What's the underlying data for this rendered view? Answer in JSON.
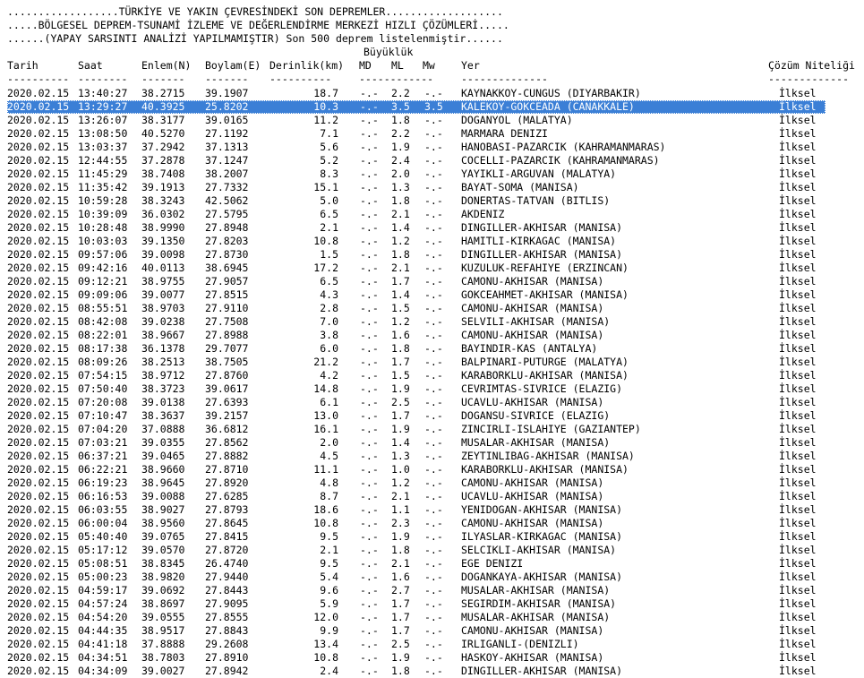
{
  "header": {
    "line1": "..................TÜRKİYE VE YAKIN ÇEVRESİNDEKİ SON DEPREMLER...................",
    "line2": ".....BÖLGESEL DEPREM-TSUNAMİ İZLEME VE DEĞERLENDİRME MERKEZİ HIZLI ÇÖZÜMLERİ.....",
    "line3": "......(YAPAY SARSINTI ANALİZİ YAPILMAMIŞTIR) Son 500 deprem listelenmiştir......",
    "magnitude_group": "Büyüklük"
  },
  "columns": {
    "date": "Tarih",
    "time": "Saat",
    "lat": "Enlem(N)",
    "lon": "Boylam(E)",
    "depth": "Derinlik(km)",
    "md": "MD",
    "ml": "ML",
    "mw": "Mw",
    "place": "Yer",
    "quality": "Çözüm Niteliği"
  },
  "separators": {
    "date": "----------",
    "time": "--------",
    "lat": "-------",
    "lon": "-------",
    "depth": "----------",
    "mag": "------------",
    "place": "--------------",
    "quality": "-------------"
  },
  "selected_index": 1,
  "rows": [
    {
      "date": "2020.02.15",
      "time": "13:40:27",
      "lat": "38.2715",
      "lon": "39.1907",
      "depth": "18.7",
      "md": "-.-",
      "ml": "2.2",
      "mw": "-.-",
      "place": "KAYNAKKOY-CUNGUS (DIYARBAKIR)",
      "quality": "İlksel"
    },
    {
      "date": "2020.02.15",
      "time": "13:29:27",
      "lat": "40.3925",
      "lon": "25.8202",
      "depth": "10.3",
      "md": "-.-",
      "ml": "3.5",
      "mw": "3.5",
      "place": "KALEKOY-GOKCEADA (CANAKKALE)",
      "quality": "İlksel"
    },
    {
      "date": "2020.02.15",
      "time": "13:26:07",
      "lat": "38.3177",
      "lon": "39.0165",
      "depth": "11.2",
      "md": "-.-",
      "ml": "1.8",
      "mw": "-.-",
      "place": "DOGANYOL (MALATYA)",
      "quality": "İlksel"
    },
    {
      "date": "2020.02.15",
      "time": "13:08:50",
      "lat": "40.5270",
      "lon": "27.1192",
      "depth": "7.1",
      "md": "-.-",
      "ml": "2.2",
      "mw": "-.-",
      "place": "MARMARA DENIZI",
      "quality": "İlksel"
    },
    {
      "date": "2020.02.15",
      "time": "13:03:37",
      "lat": "37.2942",
      "lon": "37.1313",
      "depth": "5.6",
      "md": "-.-",
      "ml": "1.9",
      "mw": "-.-",
      "place": "HANOBASI-PAZARCIK (KAHRAMANMARAS)",
      "quality": "İlksel"
    },
    {
      "date": "2020.02.15",
      "time": "12:44:55",
      "lat": "37.2878",
      "lon": "37.1247",
      "depth": "5.2",
      "md": "-.-",
      "ml": "2.4",
      "mw": "-.-",
      "place": "COCELLI-PAZARCIK (KAHRAMANMARAS)",
      "quality": "İlksel"
    },
    {
      "date": "2020.02.15",
      "time": "11:45:29",
      "lat": "38.7408",
      "lon": "38.2007",
      "depth": "8.3",
      "md": "-.-",
      "ml": "2.0",
      "mw": "-.-",
      "place": "YAYIKLI-ARGUVAN (MALATYA)",
      "quality": "İlksel"
    },
    {
      "date": "2020.02.15",
      "time": "11:35:42",
      "lat": "39.1913",
      "lon": "27.7332",
      "depth": "15.1",
      "md": "-.-",
      "ml": "1.3",
      "mw": "-.-",
      "place": "BAYAT-SOMA (MANISA)",
      "quality": "İlksel"
    },
    {
      "date": "2020.02.15",
      "time": "10:59:28",
      "lat": "38.3243",
      "lon": "42.5062",
      "depth": "5.0",
      "md": "-.-",
      "ml": "1.8",
      "mw": "-.-",
      "place": "DONERTAS-TATVAN (BITLIS)",
      "quality": "İlksel"
    },
    {
      "date": "2020.02.15",
      "time": "10:39:09",
      "lat": "36.0302",
      "lon": "27.5795",
      "depth": "6.5",
      "md": "-.-",
      "ml": "2.1",
      "mw": "-.-",
      "place": "AKDENIZ",
      "quality": "İlksel"
    },
    {
      "date": "2020.02.15",
      "time": "10:28:48",
      "lat": "38.9990",
      "lon": "27.8948",
      "depth": "2.1",
      "md": "-.-",
      "ml": "1.4",
      "mw": "-.-",
      "place": "DINGILLER-AKHISAR (MANISA)",
      "quality": "İlksel"
    },
    {
      "date": "2020.02.15",
      "time": "10:03:03",
      "lat": "39.1350",
      "lon": "27.8203",
      "depth": "10.8",
      "md": "-.-",
      "ml": "1.2",
      "mw": "-.-",
      "place": "HAMITLI-KIRKAGAC (MANISA)",
      "quality": "İlksel"
    },
    {
      "date": "2020.02.15",
      "time": "09:57:06",
      "lat": "39.0098",
      "lon": "27.8730",
      "depth": "1.5",
      "md": "-.-",
      "ml": "1.8",
      "mw": "-.-",
      "place": "DINGILLER-AKHISAR (MANISA)",
      "quality": "İlksel"
    },
    {
      "date": "2020.02.15",
      "time": "09:42:16",
      "lat": "40.0113",
      "lon": "38.6945",
      "depth": "17.2",
      "md": "-.-",
      "ml": "2.1",
      "mw": "-.-",
      "place": "KUZULUK-REFAHIYE (ERZINCAN)",
      "quality": "İlksel"
    },
    {
      "date": "2020.02.15",
      "time": "09:12:21",
      "lat": "38.9755",
      "lon": "27.9057",
      "depth": "6.5",
      "md": "-.-",
      "ml": "1.7",
      "mw": "-.-",
      "place": "CAMONU-AKHISAR (MANISA)",
      "quality": "İlksel"
    },
    {
      "date": "2020.02.15",
      "time": "09:09:06",
      "lat": "39.0077",
      "lon": "27.8515",
      "depth": "4.3",
      "md": "-.-",
      "ml": "1.4",
      "mw": "-.-",
      "place": "GOKCEAHMET-AKHISAR (MANISA)",
      "quality": "İlksel"
    },
    {
      "date": "2020.02.15",
      "time": "08:55:51",
      "lat": "38.9703",
      "lon": "27.9110",
      "depth": "2.8",
      "md": "-.-",
      "ml": "1.5",
      "mw": "-.-",
      "place": "CAMONU-AKHISAR (MANISA)",
      "quality": "İlksel"
    },
    {
      "date": "2020.02.15",
      "time": "08:42:08",
      "lat": "39.0238",
      "lon": "27.7508",
      "depth": "7.0",
      "md": "-.-",
      "ml": "1.2",
      "mw": "-.-",
      "place": "SELVILI-AKHISAR (MANISA)",
      "quality": "İlksel"
    },
    {
      "date": "2020.02.15",
      "time": "08:22:01",
      "lat": "38.9667",
      "lon": "27.8988",
      "depth": "3.8",
      "md": "-.-",
      "ml": "1.6",
      "mw": "-.-",
      "place": "CAMONU-AKHISAR (MANISA)",
      "quality": "İlksel"
    },
    {
      "date": "2020.02.15",
      "time": "08:17:38",
      "lat": "36.1378",
      "lon": "29.7077",
      "depth": "6.0",
      "md": "-.-",
      "ml": "1.8",
      "mw": "-.-",
      "place": "BAYINDIR-KAS (ANTALYA)",
      "quality": "İlksel"
    },
    {
      "date": "2020.02.15",
      "time": "08:09:26",
      "lat": "38.2513",
      "lon": "38.7505",
      "depth": "21.2",
      "md": "-.-",
      "ml": "1.7",
      "mw": "-.-",
      "place": "BALPINARI-PUTURGE (MALATYA)",
      "quality": "İlksel"
    },
    {
      "date": "2020.02.15",
      "time": "07:54:15",
      "lat": "38.9712",
      "lon": "27.8760",
      "depth": "4.2",
      "md": "-.-",
      "ml": "1.5",
      "mw": "-.-",
      "place": "KARABORKLU-AKHISAR (MANISA)",
      "quality": "İlksel"
    },
    {
      "date": "2020.02.15",
      "time": "07:50:40",
      "lat": "38.3723",
      "lon": "39.0617",
      "depth": "14.8",
      "md": "-.-",
      "ml": "1.9",
      "mw": "-.-",
      "place": "CEVRIMTAS-SIVRICE (ELAZIG)",
      "quality": "İlksel"
    },
    {
      "date": "2020.02.15",
      "time": "07:20:08",
      "lat": "39.0138",
      "lon": "27.6393",
      "depth": "6.1",
      "md": "-.-",
      "ml": "2.5",
      "mw": "-.-",
      "place": "UCAVLU-AKHISAR (MANISA)",
      "quality": "İlksel"
    },
    {
      "date": "2020.02.15",
      "time": "07:10:47",
      "lat": "38.3637",
      "lon": "39.2157",
      "depth": "13.0",
      "md": "-.-",
      "ml": "1.7",
      "mw": "-.-",
      "place": "DOGANSU-SIVRICE (ELAZIG)",
      "quality": "İlksel"
    },
    {
      "date": "2020.02.15",
      "time": "07:04:20",
      "lat": "37.0888",
      "lon": "36.6812",
      "depth": "16.1",
      "md": "-.-",
      "ml": "1.9",
      "mw": "-.-",
      "place": "ZINCIRLI-ISLAHIYE (GAZIANTEP)",
      "quality": "İlksel"
    },
    {
      "date": "2020.02.15",
      "time": "07:03:21",
      "lat": "39.0355",
      "lon": "27.8562",
      "depth": "2.0",
      "md": "-.-",
      "ml": "1.4",
      "mw": "-.-",
      "place": "MUSALAR-AKHISAR (MANISA)",
      "quality": "İlksel"
    },
    {
      "date": "2020.02.15",
      "time": "06:37:21",
      "lat": "39.0465",
      "lon": "27.8882",
      "depth": "4.5",
      "md": "-.-",
      "ml": "1.3",
      "mw": "-.-",
      "place": "ZEYTINLIBAG-AKHISAR (MANISA)",
      "quality": "İlksel"
    },
    {
      "date": "2020.02.15",
      "time": "06:22:21",
      "lat": "38.9660",
      "lon": "27.8710",
      "depth": "11.1",
      "md": "-.-",
      "ml": "1.0",
      "mw": "-.-",
      "place": "KARABORKLU-AKHISAR (MANISA)",
      "quality": "İlksel"
    },
    {
      "date": "2020.02.15",
      "time": "06:19:23",
      "lat": "38.9645",
      "lon": "27.8920",
      "depth": "4.8",
      "md": "-.-",
      "ml": "1.2",
      "mw": "-.-",
      "place": "CAMONU-AKHISAR (MANISA)",
      "quality": "İlksel"
    },
    {
      "date": "2020.02.15",
      "time": "06:16:53",
      "lat": "39.0088",
      "lon": "27.6285",
      "depth": "8.7",
      "md": "-.-",
      "ml": "2.1",
      "mw": "-.-",
      "place": "UCAVLU-AKHISAR (MANISA)",
      "quality": "İlksel"
    },
    {
      "date": "2020.02.15",
      "time": "06:03:55",
      "lat": "38.9027",
      "lon": "27.8793",
      "depth": "18.6",
      "md": "-.-",
      "ml": "1.1",
      "mw": "-.-",
      "place": "YENIDOGAN-AKHISAR (MANISA)",
      "quality": "İlksel"
    },
    {
      "date": "2020.02.15",
      "time": "06:00:04",
      "lat": "38.9560",
      "lon": "27.8645",
      "depth": "10.8",
      "md": "-.-",
      "ml": "2.3",
      "mw": "-.-",
      "place": "CAMONU-AKHISAR (MANISA)",
      "quality": "İlksel"
    },
    {
      "date": "2020.02.15",
      "time": "05:40:40",
      "lat": "39.0765",
      "lon": "27.8415",
      "depth": "9.5",
      "md": "-.-",
      "ml": "1.9",
      "mw": "-.-",
      "place": "ILYASLAR-KIRKAGAC (MANISA)",
      "quality": "İlksel"
    },
    {
      "date": "2020.02.15",
      "time": "05:17:12",
      "lat": "39.0570",
      "lon": "27.8720",
      "depth": "2.1",
      "md": "-.-",
      "ml": "1.8",
      "mw": "-.-",
      "place": "SELCIKLI-AKHISAR (MANISA)",
      "quality": "İlksel"
    },
    {
      "date": "2020.02.15",
      "time": "05:08:51",
      "lat": "38.8345",
      "lon": "26.4740",
      "depth": "9.5",
      "md": "-.-",
      "ml": "2.1",
      "mw": "-.-",
      "place": "EGE DENIZI",
      "quality": "İlksel"
    },
    {
      "date": "2020.02.15",
      "time": "05:00:23",
      "lat": "38.9820",
      "lon": "27.9440",
      "depth": "5.4",
      "md": "-.-",
      "ml": "1.6",
      "mw": "-.-",
      "place": "DOGANKAYA-AKHISAR (MANISA)",
      "quality": "İlksel"
    },
    {
      "date": "2020.02.15",
      "time": "04:59:17",
      "lat": "39.0692",
      "lon": "27.8443",
      "depth": "9.6",
      "md": "-.-",
      "ml": "2.7",
      "mw": "-.-",
      "place": "MUSALAR-AKHISAR (MANISA)",
      "quality": "İlksel"
    },
    {
      "date": "2020.02.15",
      "time": "04:57:24",
      "lat": "38.8697",
      "lon": "27.9095",
      "depth": "5.9",
      "md": "-.-",
      "ml": "1.7",
      "mw": "-.-",
      "place": "SEGIRDIM-AKHISAR (MANISA)",
      "quality": "İlksel"
    },
    {
      "date": "2020.02.15",
      "time": "04:54:20",
      "lat": "39.0555",
      "lon": "27.8555",
      "depth": "12.0",
      "md": "-.-",
      "ml": "1.7",
      "mw": "-.-",
      "place": "MUSALAR-AKHISAR (MANISA)",
      "quality": "İlksel"
    },
    {
      "date": "2020.02.15",
      "time": "04:44:35",
      "lat": "38.9517",
      "lon": "27.8843",
      "depth": "9.9",
      "md": "-.-",
      "ml": "1.7",
      "mw": "-.-",
      "place": "CAMONU-AKHISAR (MANISA)",
      "quality": "İlksel"
    },
    {
      "date": "2020.02.15",
      "time": "04:41:18",
      "lat": "37.8888",
      "lon": "29.2608",
      "depth": "13.4",
      "md": "-.-",
      "ml": "2.5",
      "mw": "-.-",
      "place": "IRLIGANLI-(DENIZLI)",
      "quality": "İlksel"
    },
    {
      "date": "2020.02.15",
      "time": "04:34:51",
      "lat": "38.7803",
      "lon": "27.8910",
      "depth": "10.8",
      "md": "-.-",
      "ml": "1.9",
      "mw": "-.-",
      "place": "HASKOY-AKHISAR (MANISA)",
      "quality": "İlksel"
    },
    {
      "date": "2020.02.15",
      "time": "04:34:09",
      "lat": "39.0027",
      "lon": "27.8942",
      "depth": "2.4",
      "md": "-.-",
      "ml": "1.8",
      "mw": "-.-",
      "place": "DINGILLER-AKHISAR (MANISA)",
      "quality": "İlksel"
    }
  ]
}
